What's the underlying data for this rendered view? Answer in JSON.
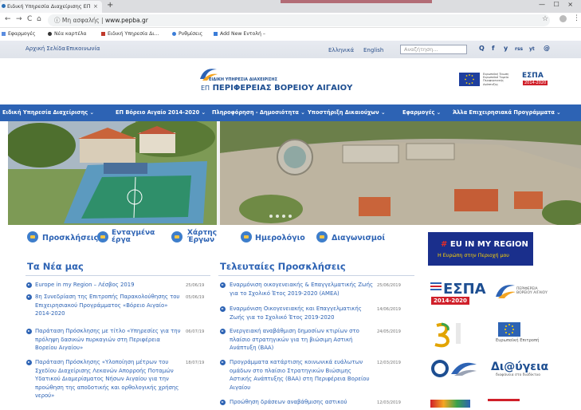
{
  "browser": {
    "tab_title": "Ειδική Υπηρεσία Διαχείρισης ΕΠ",
    "tab_close": "×",
    "new_tab": "+",
    "window_controls": "— ☐ ×",
    "nav": {
      "back": "←",
      "forward": "→",
      "reload": "C",
      "home": "⌂"
    },
    "url_prefix": "ⓘ Μη ασφαλής |",
    "url_host": "www.pepba.gr",
    "star": "☆",
    "menu": "⋮",
    "bookmarks": [
      "Εφαρμογές",
      "Νέα καρτέλα",
      "Ειδική Υπηρεσία Δι...",
      "Ρυθμίσεις",
      "Add New Εντολή –"
    ]
  },
  "utility": {
    "home": "Αρχική Σελίδα",
    "contact": "Επικοινωνία",
    "lang_el": "Ελληνικά",
    "lang_en": "English",
    "search_placeholder": "Αναζήτηση...",
    "social": [
      "Q",
      "f",
      "y",
      "rss",
      "yt",
      "@"
    ]
  },
  "header": {
    "logo_line1": "ΕΙΔΙΚΗ ΥΠΗΡΕΣΙΑ ΔΙΑΧΕΙΡΙΣΗΣ",
    "logo_prefix": "ΕΠ",
    "logo_line2": "ΠΕΡΙΦΕΡΕΙΑΣ ΒΟΡΕΙΟΥ ΑΙΓΑΙΟΥ",
    "eu_text": "Ευρωπαϊκή Ένωση Ευρωπαϊκό Ταμείο Περιφερειακής Ανάπτυξης",
    "espa": "ΕΣΠΑ",
    "espa_years": "2014-2020"
  },
  "nav": [
    "Ειδική Υπηρεσία Διαχείρισης ⌄",
    "ΕΠ Βόρειο Αιγαίο 2014-2020 ⌄",
    "Πληροφόρηση - Δημοσιότητα ⌄",
    "Υποστήριξη Δικαιούχων ⌄",
    "Εφαρμογές ⌄",
    "Άλλα Επιχειρησιακά Προγράμματα ⌄"
  ],
  "quick_links": {
    "calls": "Προσκλήσεις",
    "projects_1": "Ενταγμένα",
    "projects_2": "έργα",
    "maps_1": "Χάρτης",
    "maps_2": "Έργων",
    "calendar": "Ημερολόγιο",
    "tenders": "Διαγωνισμοί"
  },
  "news": {
    "title": "Τα Νέα μας",
    "items": [
      {
        "text": "Europe in my Region – Λέσβος 2019",
        "date": "25/06/19"
      },
      {
        "text": "8η Συνεδρίαση της Επιτροπής Παρακολούθησης του Επιχειρησιακού Προγράμματος «Βόρειο Αιγαίο» 2014-2020",
        "date": "05/06/19"
      },
      {
        "text": "Παράταση Πρόσκλησης με τίτλο «Υπηρεσίες για την πρόληψη δασικών πυρκαγιών στη Περιφέρεια Βορείου Αιγαίου»",
        "date": "06/07/19"
      },
      {
        "text": "Παράταση Πρόσκλησης «Υλοποίηση μέτρων του Σχεδίου Διαχείρισης Λεκανών Απορροής Ποταμών Υδατικού Διαμερίσματος Νήσων Αιγαίου για την προώθηση της αποδοτικής και ορθολογικής χρήσης νερού»",
        "date": "18/07/19"
      }
    ]
  },
  "calls": {
    "title": "Τελευταίες Προσκλήσεις",
    "items": [
      {
        "text": "Εναρμόνιση οικογενειακής & Επαγγελματικής Ζωής για το Σχολικό Έτος 2019-2020 (ΑΜΕΑ)",
        "date": "25/06/2019"
      },
      {
        "text": "Εναρμόνιση Οικογενειακής και Επαγγελματικής Ζωής για το Σχολικό Έτος 2019-2020",
        "date": "14/06/2019"
      },
      {
        "text": "Ενεργειακή αναβάθμιση δημοσίων κτιρίων στο πλαίσιο στρατηγικών για τη βιώσιμη Αστική Ανάπτυξη (ΒΑΑ)",
        "date": "24/05/2019"
      },
      {
        "text": "Προγράμματα κατάρτισης κοινωνικά ευάλωτων ομάδων στο πλαίσιο Στρατηγικών Βιώσιμης Αστικής Ανάπτυξης (ΒΑΑ) στη Περιφέρεια Βορείου Αιγαίου",
        "date": "12/03/2019"
      },
      {
        "text": "Προώθηση δράσεων αναβάθμισης αστικού",
        "date": "12/03/2019"
      }
    ]
  },
  "sidebar": {
    "eu_region_1": "EU IN MY REGION",
    "eu_region_2": "Η Ευρώπη στην Περιοχή μου",
    "espa": "ΕΣΠΑ",
    "espa_years": "2014-2020",
    "region_logo": "ΠΕΡΙΦΕΡΕΙΑ ΒΟΡΕΙΟΥ ΑΙΓΑΙΟΥ",
    "eu_commission": "Ευρωπαϊκή Επιτροπή",
    "diavgeia": "Δι@ύγεια",
    "diavgeia_sub": "διαφάνεια στο διαδίκτυο"
  },
  "colors": {
    "brand_blue": "#2d63b4",
    "nav_blue": "#2d63b4",
    "espa_red": "#d0202a",
    "eu_navy": "#1a2f8c"
  }
}
